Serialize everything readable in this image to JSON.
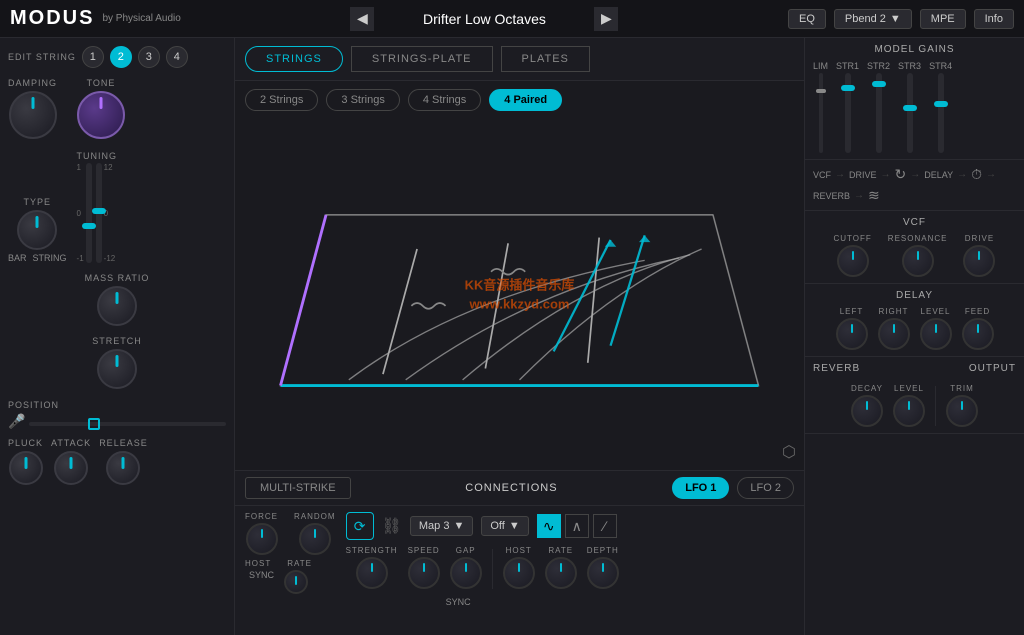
{
  "app": {
    "name": "MODUS",
    "subtitle": "by Physical Audio"
  },
  "preset": {
    "name": "Drifter Low Octaves",
    "prev_label": "◀",
    "next_label": "▶"
  },
  "top_right": {
    "eq_label": "EQ",
    "pbend_label": "Pbend 2",
    "mpe_label": "MPE",
    "info_label": "Info"
  },
  "edit_string": {
    "label": "EDIT STRING",
    "buttons": [
      "1",
      "2",
      "3",
      "4"
    ],
    "active": 1
  },
  "left_panel": {
    "damping_label": "DAMPING",
    "tone_label": "TONE",
    "type_label": "TYPE",
    "tuning_label": "TUNING",
    "bar_label": "BAR",
    "string_label": "STRING",
    "mass_ratio_label": "MASS RATIO",
    "stretch_label": "STRETCH",
    "position_label": "POSITION",
    "pluck_label": "PLUCK",
    "attack_label": "ATTACK",
    "release_label": "RELEASE"
  },
  "center_tabs": {
    "strings_label": "STRINGS",
    "strings_plate_label": "STRINGS-PLATE",
    "plates_label": "PLATES"
  },
  "string_count_buttons": {
    "two": "2 Strings",
    "three": "3 Strings",
    "four": "4 Strings",
    "four_paired": "4 Paired"
  },
  "bottom_section": {
    "multi_strike_label": "MULTI-STRIKE",
    "connections_label": "CONNECTIONS",
    "lfo1_label": "LFO 1",
    "lfo2_label": "LFO 2",
    "force_label": "FORCE",
    "random_label": "RANDOM",
    "host_label": "HOST",
    "rate_label": "RATE",
    "sync_label": "SYNC",
    "strength_label": "STRENGTH",
    "speed_label": "SPEED",
    "gap_label": "GAP",
    "host2_label": "HOST",
    "rate2_label": "RATE",
    "depth_label": "DEPTH",
    "sync2_label": "SYNC",
    "map_label": "Map 3",
    "off_label": "Off"
  },
  "right_panel": {
    "model_gains_label": "MODEL GAINS",
    "lim_label": "LIM",
    "str1_label": "STR1",
    "str2_label": "STR2",
    "str3_label": "STR3",
    "str4_label": "STR4",
    "vcf_label": "VCF",
    "drive_label": "DRIVE",
    "delay_label": "DELAY",
    "reverb_label": "REVERB",
    "vcf_section_label": "VCF",
    "cutoff_label": "CUTOFF",
    "resonance_label": "RESONANCE",
    "drive2_label": "DRIVE",
    "delay_section_label": "DELAY",
    "left_label": "LEFT",
    "right_label": "RIGHT",
    "level_label": "LEVEL",
    "feed_label": "FEED",
    "reverb_section_label": "REVERB",
    "output_label": "OUTPUT",
    "decay_label": "DECAY",
    "level2_label": "LEVEL",
    "trim_label": "TRIM"
  }
}
